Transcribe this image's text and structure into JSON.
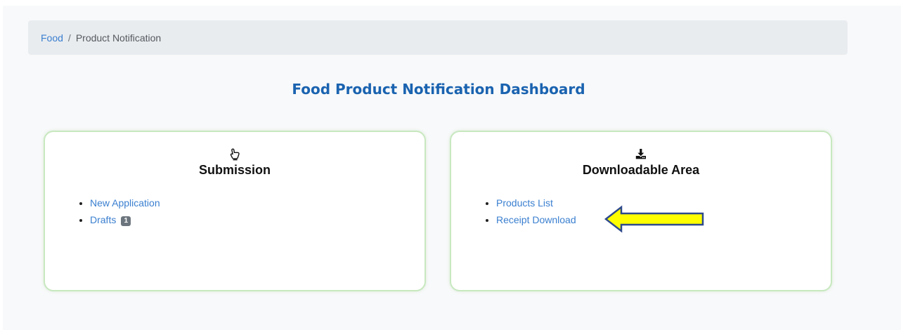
{
  "breadcrumb": {
    "items": [
      {
        "label": "Food",
        "link": true
      },
      {
        "label": "Product Notification",
        "link": false
      }
    ],
    "separator": "/"
  },
  "page_title": "Food Product Notification Dashboard",
  "cards": {
    "submission": {
      "icon": "pointing-hand-icon",
      "title": "Submission",
      "links": {
        "new_application": "New Application",
        "drafts": "Drafts",
        "drafts_count": "1"
      }
    },
    "downloadable": {
      "icon": "download-icon",
      "title": "Downloadable Area",
      "links": {
        "products_list": "Products List",
        "receipt_download": "Receipt Download"
      }
    }
  },
  "annotation": {
    "icon": "left-arrow-icon",
    "fill_color": "#ffff00",
    "stroke_color": "#2e4a8c"
  },
  "colors": {
    "link": "#3a7fd0",
    "title": "#1a63b0",
    "card_border": "#c8e8c0",
    "badge": "#6c757d"
  }
}
